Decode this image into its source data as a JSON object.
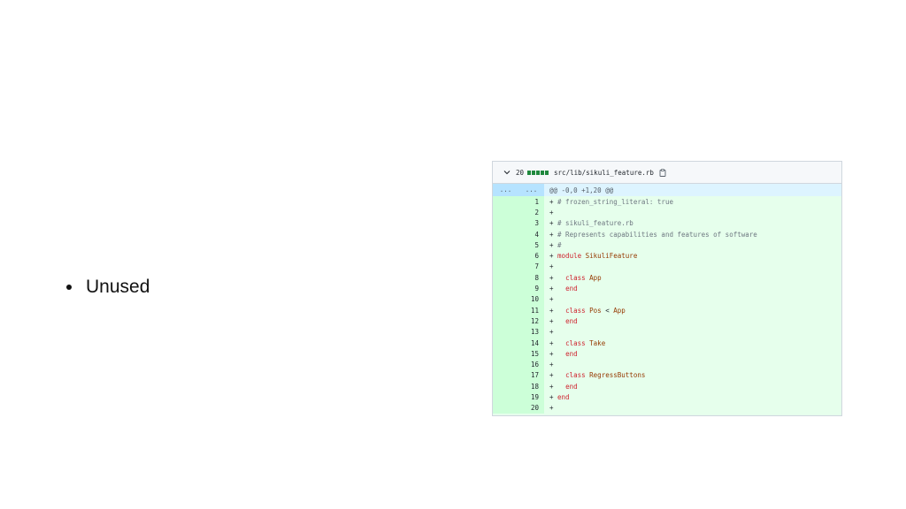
{
  "slide": {
    "bullets": [
      "Unused"
    ]
  },
  "diff": {
    "changes_count": "20",
    "file_path": "src/lib/sikuli_feature.rb",
    "hunk_header": "@@ -0,0 +1,20 @@",
    "expand_left": "...",
    "expand_right": "...",
    "lines": [
      {
        "num": "1",
        "text": "# frozen_string_literal: true"
      },
      {
        "num": "2",
        "text": ""
      },
      {
        "num": "3",
        "text": "# sikuli_feature.rb"
      },
      {
        "num": "4",
        "text": "# Represents capabilities and features of software"
      },
      {
        "num": "5",
        "text": "#"
      },
      {
        "num": "6",
        "text": "module SikuliFeature"
      },
      {
        "num": "7",
        "text": ""
      },
      {
        "num": "8",
        "text": "  class App"
      },
      {
        "num": "9",
        "text": "  end"
      },
      {
        "num": "10",
        "text": ""
      },
      {
        "num": "11",
        "text": "  class Pos < App"
      },
      {
        "num": "12",
        "text": "  end"
      },
      {
        "num": "13",
        "text": ""
      },
      {
        "num": "14",
        "text": "  class Take"
      },
      {
        "num": "15",
        "text": "  end"
      },
      {
        "num": "16",
        "text": ""
      },
      {
        "num": "17",
        "text": "  class RegressButtons"
      },
      {
        "num": "18",
        "text": "  end"
      },
      {
        "num": "19",
        "text": "end"
      },
      {
        "num": "20",
        "text": ""
      }
    ]
  },
  "colors": {
    "added_bg": "#e6ffec",
    "added_gutter": "#ccffd8",
    "hunk_bg": "#ddf4ff",
    "diffstat_green": "#1f883d"
  },
  "icons": {
    "collapse": "chevron-down-icon",
    "copy": "copy-icon"
  }
}
